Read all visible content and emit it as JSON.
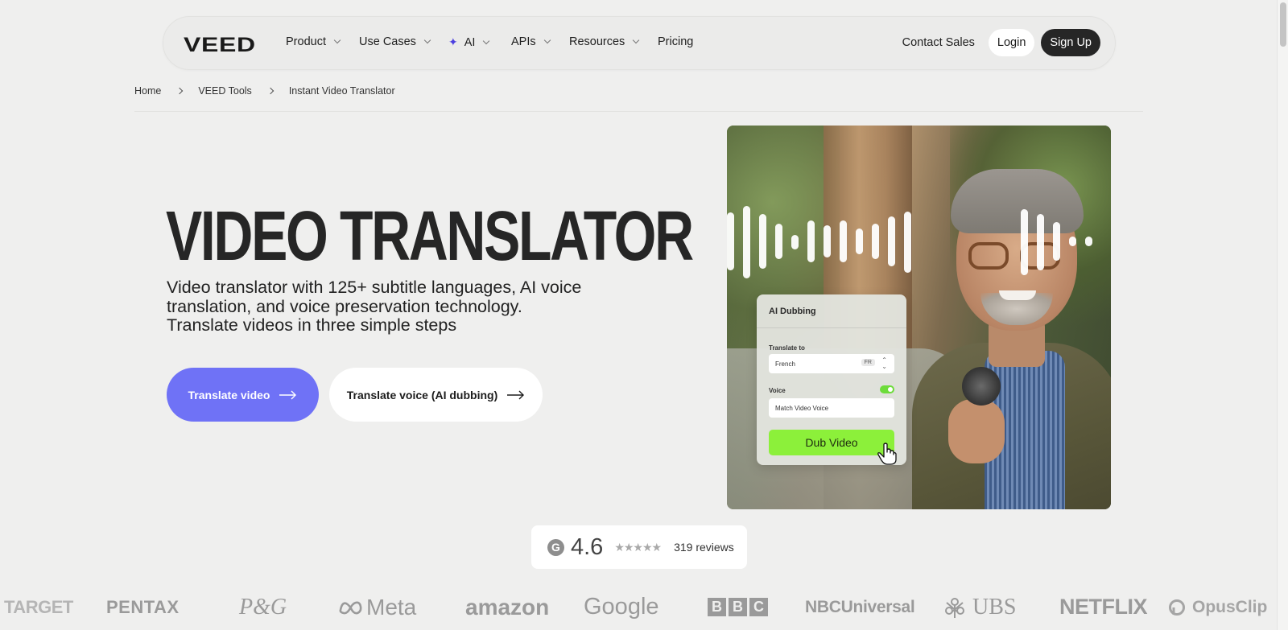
{
  "nav": {
    "logo": "VEED",
    "items": [
      {
        "label": "Product",
        "has_dropdown": true
      },
      {
        "label": "Use Cases",
        "has_dropdown": true
      },
      {
        "label": "AI",
        "has_dropdown": true,
        "icon": "sparkle-icon"
      },
      {
        "label": "APIs",
        "has_dropdown": true
      },
      {
        "label": "Resources",
        "has_dropdown": true
      },
      {
        "label": "Pricing",
        "has_dropdown": false
      }
    ],
    "contact_sales": "Contact Sales",
    "login": "Login",
    "signup": "Sign Up"
  },
  "breadcrumb": [
    "Home",
    "VEED Tools",
    "Instant Video Translator"
  ],
  "hero": {
    "title": "VIDEO TRANSLATOR",
    "subtitle": "Video translator with 125+ subtitle languages, AI voice translation, and voice preservation technology. Translate videos in three simple steps",
    "primary_cta": "Translate video",
    "secondary_cta": "Translate voice (AI dubbing)"
  },
  "dubbing_card": {
    "title": "AI Dubbing",
    "translate_to_label": "Translate to",
    "language": "French",
    "language_code": "FR",
    "voice_label": "Voice",
    "voice_toggle_on": true,
    "voice_value": "Match Video Voice",
    "button": "Dub Video"
  },
  "rating": {
    "icon": "g2-icon",
    "icon_letter": "G",
    "value": "4.6",
    "stars": "★★★★★",
    "reviews": "319 reviews"
  },
  "logos": {
    "target": "TARGET",
    "pentax": "PENTAX",
    "pg": "P&G",
    "meta": "Meta",
    "amazon": "amazon",
    "google": "Google",
    "bbc": [
      "B",
      "B",
      "C"
    ],
    "nbcuniversal": "NBCUniversal",
    "ubs": "UBS",
    "netflix": "NETFLIX",
    "opusclip": "OpusClip"
  },
  "colors": {
    "page_bg": "#efefee",
    "primary_button": "#6f72f6",
    "signup_button": "#262626",
    "dub_button": "#8cf03a",
    "sparkle": "#4b3fe0"
  }
}
